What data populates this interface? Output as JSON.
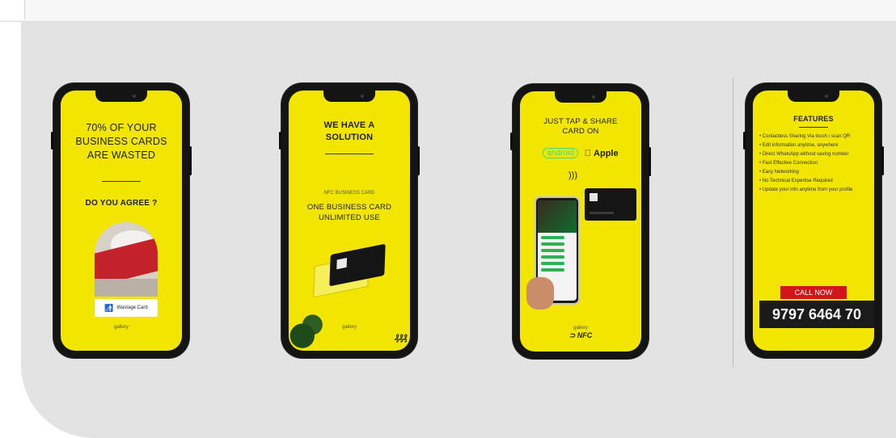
{
  "phones": [
    {
      "headline": "70% OF YOUR BUSINESS CARDS ARE WASTED",
      "question": "DO YOU AGREE ?",
      "card_label": "Wastage Card",
      "footer": "gallery"
    },
    {
      "headline": "WE HAVE A SOLUTION",
      "kicker": "NFC BUSINESS CARD",
      "subhead": "ONE BUSINESS CARD UNLIMITED USE",
      "footer": "gallery"
    },
    {
      "headline": "JUST TAP & SHARE CARD ON",
      "android_label": "android",
      "apple_label": "Apple",
      "footer": "gallery",
      "brand": "NFC"
    },
    {
      "headline": "FEATURES",
      "features": [
        "• Contactless Sharing Via touch / scan QR",
        "• Edit information anytime, anywhere",
        "• Direct WhatsApp without saving number",
        "• Fast Effective Connection",
        "• Easy Networking",
        "• No Technical Expertise Required",
        "• Update your info anytime from your profile"
      ],
      "cta": "CALL NOW",
      "phone_number": "9797 6464 70"
    }
  ],
  "colors": {
    "screen": "#f2e600",
    "panel": "#e3e3e3",
    "cta": "#d3141a"
  }
}
